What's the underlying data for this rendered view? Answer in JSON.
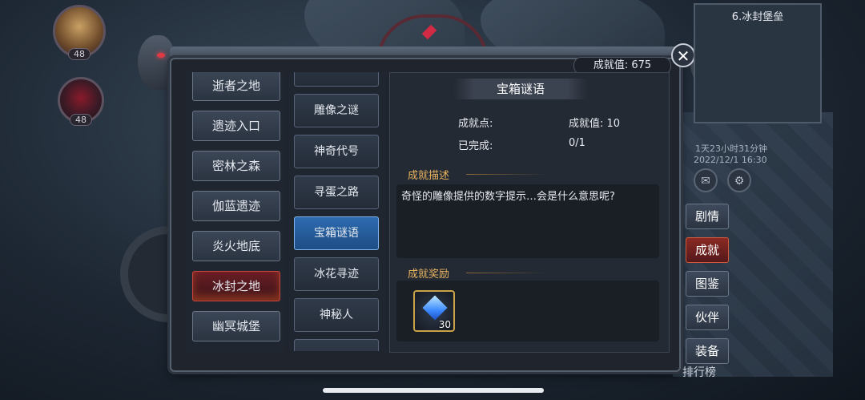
{
  "player": {
    "level_1": "48",
    "level_2": "48"
  },
  "header": {
    "score_label": "成就值: 675",
    "close_symbol": "✕"
  },
  "regions": [
    {
      "label": "逝者之地",
      "active": false
    },
    {
      "label": "遗迹入口",
      "active": false
    },
    {
      "label": "密林之森",
      "active": false
    },
    {
      "label": "伽蓝遗迹",
      "active": false
    },
    {
      "label": "炎火地底",
      "active": false
    },
    {
      "label": "冰封之地",
      "active": true
    },
    {
      "label": "幽冥城堡",
      "active": false
    }
  ],
  "achievements": [
    {
      "label": "雕像之谜",
      "active": false
    },
    {
      "label": "神奇代号",
      "active": false
    },
    {
      "label": "寻蛋之路",
      "active": false
    },
    {
      "label": "宝箱谜语",
      "active": true
    },
    {
      "label": "冰花寻迹",
      "active": false
    },
    {
      "label": "神秘人",
      "active": false
    }
  ],
  "detail": {
    "title": "宝箱谜语",
    "points_label": "成就点:",
    "points_value": "成就值: 10",
    "done_label": "已完成:",
    "done_value": "0/1",
    "desc_header": "成就描述",
    "description": "奇怪的雕像提供的数字提示…会是什么意思呢?",
    "reward_header": "成就奖励",
    "reward": {
      "icon": "diamond-icon",
      "qty": "30"
    }
  },
  "side": {
    "map_title": "6.冰封堡垒",
    "timer": "1天23小时31分钟",
    "date": "2022/12/1 16:30",
    "buttons": [
      {
        "label": "剧情",
        "active": false
      },
      {
        "label": "成就",
        "active": true
      },
      {
        "label": "图鉴",
        "active": false
      },
      {
        "label": "伙伴",
        "active": false
      },
      {
        "label": "装备",
        "active": false
      }
    ],
    "rank_label": "排行榜"
  },
  "colors": {
    "accent_gold": "#e8b460",
    "active_blue": "#2d6bb0",
    "active_red": "#8a2a24"
  }
}
